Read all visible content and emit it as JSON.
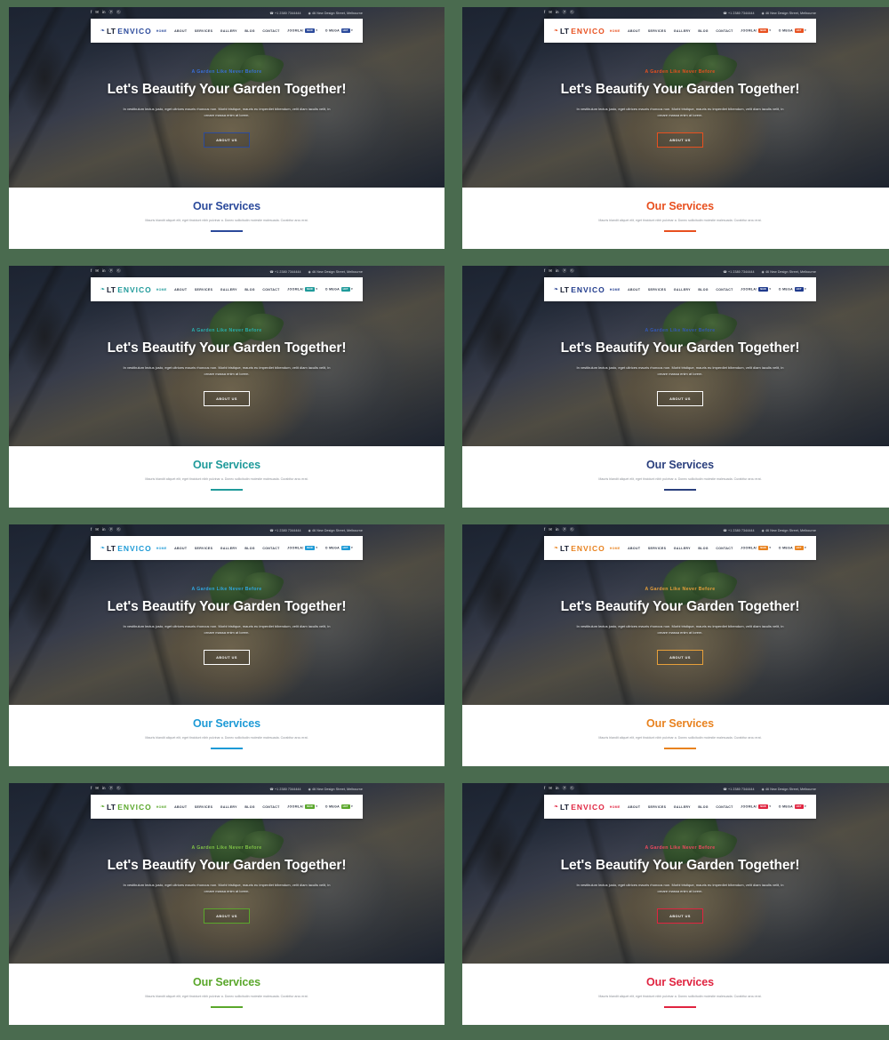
{
  "page": {
    "background_color": "#4a6b4f",
    "layout": "2x4 grid of template color-variant previews",
    "variant_count": 8
  },
  "shared": {
    "topbar": {
      "social_icons": [
        "facebook-icon",
        "twitter-icon",
        "linkedin-icon",
        "pinterest-icon",
        "google-plus-icon"
      ],
      "social_glyphs": [
        "f",
        "✉",
        "in",
        "ⓟ",
        "Ⓖ"
      ],
      "phone_icon": "phone-icon",
      "phone": "+1 2380 7344444",
      "location_icon": "map-pin-icon",
      "address": "46 New Design Street, Melbourne"
    },
    "brand": {
      "mark": "leaf-icon",
      "name_part1": "LT",
      "name_part2": "ENVICO"
    },
    "menu": [
      {
        "label": "HOME",
        "active": true
      },
      {
        "label": "ABOUT",
        "active": false
      },
      {
        "label": "SERVICES",
        "active": false
      },
      {
        "label": "GALLERY",
        "active": false
      },
      {
        "label": "BLOG",
        "active": false
      },
      {
        "label": "CONTACT",
        "active": false
      },
      {
        "label": "JOOMLA!",
        "badge": "NEW",
        "caret": true,
        "active": false
      },
      {
        "label": "O MEGA",
        "badge": "HOT",
        "caret": true,
        "active": false
      }
    ],
    "hero": {
      "tagline": "A Garden Like Never Before",
      "headline": "Let's Beautify Your Garden Together!",
      "description": "In vestibulum lectus justo, eget ultrices mauris rhoncus non. Morbi tristique, mauris eu imperdiet bibendum, velit diam iaculis velit, in ornare massa enim at lorem.",
      "button_label": "ABOUT US"
    },
    "services": {
      "title": "Our Services",
      "description": "Mauris blandit aliquet elit, eget tincidunt nibh pulvinar a. Donec sollicitudin molestie malesuada. Curabitur arcu erat."
    }
  },
  "variants": [
    {
      "id": 1,
      "name": "navy-blue",
      "accent": "#2b4a9b",
      "tagline_color": "#3a6fd8",
      "badge_color": "#2b4a9b",
      "button_border": "#2b4a9b",
      "svc_title_color": "#2b4a9b",
      "svc_rule_color": "#2b4a9b"
    },
    {
      "id": 2,
      "name": "orange-red",
      "accent": "#e8501f",
      "tagline_color": "#e8501f",
      "badge_color": "#e8501f",
      "button_border": "#e8501f",
      "svc_title_color": "#e8501f",
      "svc_rule_color": "#e8501f"
    },
    {
      "id": 3,
      "name": "teal",
      "accent": "#1f9a9a",
      "tagline_color": "#29b0ad",
      "badge_color": "#1f9a9a",
      "button_border": "#ffffff",
      "svc_title_color": "#1f9a9a",
      "svc_rule_color": "#1f9a9a"
    },
    {
      "id": 4,
      "name": "deep-navy",
      "accent": "#1f3a8c",
      "tagline_color": "#3458b5",
      "badge_color": "#1f3a8c",
      "button_border": "#ffffff",
      "svc_title_color": "#2a3f7d",
      "svc_rule_color": "#2a3f7d"
    },
    {
      "id": 5,
      "name": "sky-blue",
      "accent": "#1d9ad6",
      "tagline_color": "#2fa8e0",
      "badge_color": "#1d9ad6",
      "button_border": "#ffffff",
      "svc_title_color": "#1d9ad6",
      "svc_rule_color": "#1d9ad6"
    },
    {
      "id": 6,
      "name": "amber",
      "accent": "#e8821f",
      "tagline_color": "#e8a03a",
      "badge_color": "#e8821f",
      "button_border": "#e8a03a",
      "svc_title_color": "#e8821f",
      "svc_rule_color": "#e8821f"
    },
    {
      "id": 7,
      "name": "green",
      "accent": "#5aa72b",
      "tagline_color": "#7fc246",
      "badge_color": "#5aa72b",
      "button_border": "#5aa72b",
      "svc_title_color": "#5aa72b",
      "svc_rule_color": "#5aa72b"
    },
    {
      "id": 8,
      "name": "crimson",
      "accent": "#e02440",
      "tagline_color": "#ef4a60",
      "badge_color": "#e02440",
      "button_border": "#e02440",
      "svc_title_color": "#e02440",
      "svc_rule_color": "#e02440"
    }
  ]
}
